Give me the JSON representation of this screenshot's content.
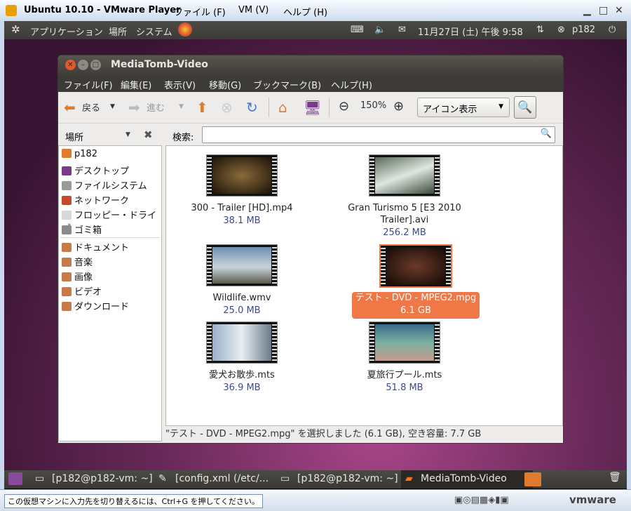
{
  "vmware": {
    "title": "Ubuntu 10.10 - VMware Player",
    "menus": [
      "ファイル (F)",
      "VM (V)",
      "ヘルプ (H)"
    ],
    "hint": "この仮想マシンに入力先を切り替えるには、Ctrl+G を押してください。",
    "brand": "vmware"
  },
  "gnome": {
    "menus": [
      "アプリケーション",
      "場所",
      "システム"
    ],
    "clock": "11月27日 (土) 午後 9:58",
    "user": "p182"
  },
  "window": {
    "title": "MediaTomb-Video",
    "menu": [
      "ファイル(F)",
      "編集(E)",
      "表示(V)",
      "移動(G)",
      "ブックマーク(B)",
      "ヘルプ(H)"
    ],
    "back": "戻る",
    "forward": "進む",
    "zoom": "150%",
    "view_mode": "アイコン表示",
    "places_label": "場所",
    "search_label": "検索:",
    "search_value": ""
  },
  "sidebar": {
    "items": [
      "p182",
      "デスクトップ",
      "ファイルシステム",
      "ネットワーク",
      "フロッピー・ドライブ",
      "ゴミ箱"
    ],
    "bookmarks": [
      "ドキュメント",
      "音楽",
      "画像",
      "ビデオ",
      "ダウンロード"
    ]
  },
  "files": [
    {
      "name": "300 - Trailer [HD].mp4",
      "size": "38.1 MB"
    },
    {
      "name": "Gran Turismo 5 [E3 2010 Trailer].avi",
      "size": "256.2 MB"
    },
    {
      "name": "Wildlife.wmv",
      "size": "25.0 MB"
    },
    {
      "name": "テスト - DVD - MPEG2.mpg",
      "size": "6.1 GB"
    },
    {
      "name": "愛犬お散歩.mts",
      "size": "36.9 MB"
    },
    {
      "name": "夏旅行プール.mts",
      "size": "51.8 MB"
    }
  ],
  "status": "\"テスト - DVD - MPEG2.mpg\" を選択しました (6.1 GB), 空き容量: 7.7 GB",
  "taskbar": [
    "[p182@p182-vm: ~]",
    "[config.xml (/etc/...",
    "[p182@p182-vm: ~]",
    "MediaTomb-Video"
  ],
  "colors": {
    "selection": "#f07746",
    "size_text": "#3d4a8a"
  }
}
